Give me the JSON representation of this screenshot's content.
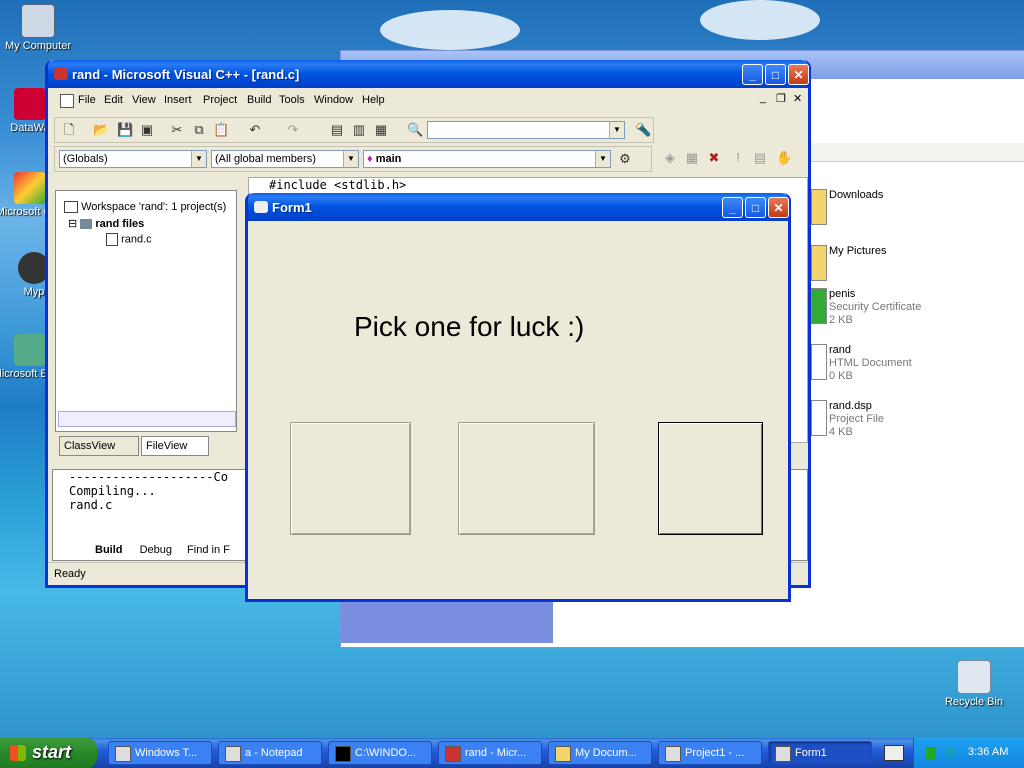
{
  "desktop": {
    "icons": [
      {
        "label": "My Computer"
      },
      {
        "label": "DataWa"
      },
      {
        "label": "Microsoft C++"
      },
      {
        "label": "Myp"
      },
      {
        "label": "Microsoft Basic"
      },
      {
        "label": "Recycle Bin"
      }
    ]
  },
  "explorer": {
    "files": [
      {
        "name": "Downloads",
        "type": "",
        "size": ""
      },
      {
        "name": "My Pictures",
        "type": "",
        "size": ""
      },
      {
        "name": "penis",
        "type": "Security Certificate",
        "size": "2 KB"
      },
      {
        "name": "rand",
        "type": "HTML Document",
        "size": "0 KB"
      },
      {
        "name": "rand.dsp",
        "type": "Project File",
        "size": "4 KB"
      }
    ]
  },
  "vc": {
    "title": "rand - Microsoft Visual C++ - [rand.c]",
    "menu": [
      "File",
      "Edit",
      "View",
      "Insert",
      "Project",
      "Build",
      "Tools",
      "Window",
      "Help"
    ],
    "combos": {
      "globals": "(Globals)",
      "members": "(All global members)",
      "func": "main"
    },
    "workspace": {
      "root": "Workspace 'rand': 1 project(s)",
      "project": "rand files",
      "file": "rand.c"
    },
    "tabs": {
      "classview": "ClassView",
      "fileview": "FileView"
    },
    "editor_line": "#include <stdlib.h>",
    "output": {
      "rule": "--------------------Co",
      "lines": [
        "Compiling...",
        "rand.c"
      ]
    },
    "output_tabs": [
      "Build",
      "Debug",
      "Find in F"
    ],
    "status": "Ready"
  },
  "form1": {
    "title": "Form1",
    "headline": "Pick one for luck :)"
  },
  "taskbar": {
    "start": "start",
    "tasks": [
      "Windows T...",
      "a - Notepad",
      "C:\\WINDO...",
      "rand - Micr...",
      "My Docum...",
      "Project1 - ...",
      "Form1"
    ],
    "clock": "3:36 AM"
  }
}
